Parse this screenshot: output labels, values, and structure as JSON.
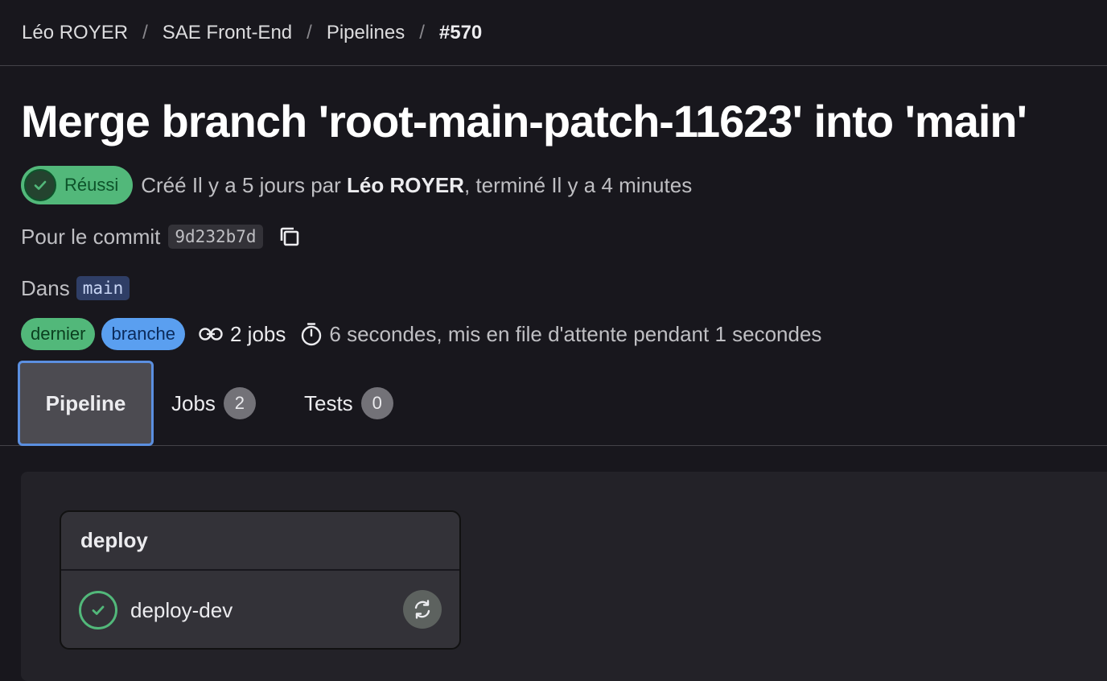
{
  "breadcrumb": {
    "items": [
      "Léo ROYER",
      "SAE Front-End",
      "Pipelines"
    ],
    "current": "#570",
    "separator": "/"
  },
  "pipeline": {
    "title": "Merge branch 'root-main-patch-11623' into 'main'",
    "status": "Réussi",
    "created_text": "Créé Il y a 5 jours par",
    "author": "Léo ROYER",
    "finished_text": ", terminé Il y a 4 minutes",
    "commit_label": "Pour le commit",
    "commit_sha": "9d232b7d",
    "ref_label": "Dans",
    "ref": "main",
    "badges": [
      "dernier",
      "branche"
    ],
    "jobs_count_text": "2 jobs",
    "duration_text": "6 secondes, mis en file d'attente pendant 1 secondes"
  },
  "tabs": [
    {
      "label": "Pipeline",
      "count": null,
      "active": true
    },
    {
      "label": "Jobs",
      "count": "2",
      "active": false
    },
    {
      "label": "Tests",
      "count": "0",
      "active": false
    }
  ],
  "graph": {
    "stage_name": "deploy",
    "job_name": "deploy-dev"
  },
  "colors": {
    "background": "#18171d",
    "success": "#52b87a",
    "accent": "#5b8fe0"
  },
  "icons": [
    "check-circle-icon",
    "copy-icon",
    "pipeline-jobs-icon",
    "timer-icon",
    "retry-icon"
  ]
}
